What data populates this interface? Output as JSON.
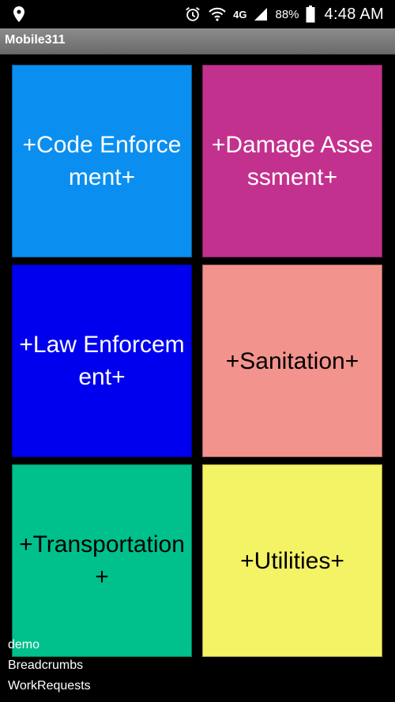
{
  "status_bar": {
    "network": "4G",
    "battery": "88%",
    "time": "4:48 AM",
    "icons": [
      "location-icon",
      "alarm-icon",
      "wifi-icon",
      "signal-icon",
      "battery-icon"
    ]
  },
  "app_bar": {
    "title": "Mobile311"
  },
  "tiles": [
    {
      "label": "+Code Enforcement+",
      "color": "#0a8ff0"
    },
    {
      "label": "+Damage Assessment+",
      "color": "#c3318f"
    },
    {
      "label": "+Law Enforcement+",
      "color": "#0000ee"
    },
    {
      "label": "+Sanitation+",
      "color": "#f3938d"
    },
    {
      "label": "+Transportation+",
      "color": "#00c08c"
    },
    {
      "label": "+Utilities+",
      "color": "#f4f265"
    }
  ],
  "footer": {
    "items": [
      "demo",
      "Breadcrumbs",
      "WorkRequests"
    ]
  }
}
